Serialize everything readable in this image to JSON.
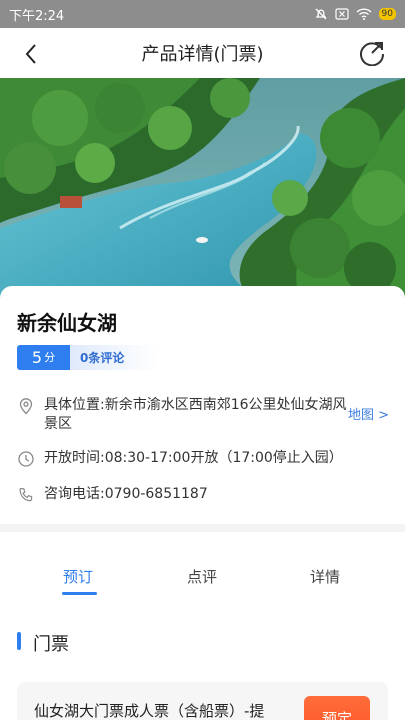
{
  "status_bar": {
    "time": "下午2:24",
    "battery": "90"
  },
  "header": {
    "title": "产品详情(门票)"
  },
  "product": {
    "name": "新余仙女湖",
    "score": "5",
    "score_unit": "分",
    "review_count": "0条评论",
    "address": "具体位置:新余市渝水区西南郊16公里处仙女湖风景区",
    "map_link": "地图 >",
    "hours": "开放时间:08:30-17:00开放（17:00停止入园）",
    "phone": "咨询电话:0790-6851187"
  },
  "tabs": [
    {
      "label": "预订",
      "active": true
    },
    {
      "label": "点评",
      "active": false
    },
    {
      "label": "详情",
      "active": false
    }
  ],
  "section": {
    "title": "门票"
  },
  "ticket": {
    "name": "仙女湖大门票成人票（含船票）-提",
    "book_label": "预定"
  },
  "colors": {
    "accent": "#2f7ef0",
    "book": "#ff5a2c"
  }
}
